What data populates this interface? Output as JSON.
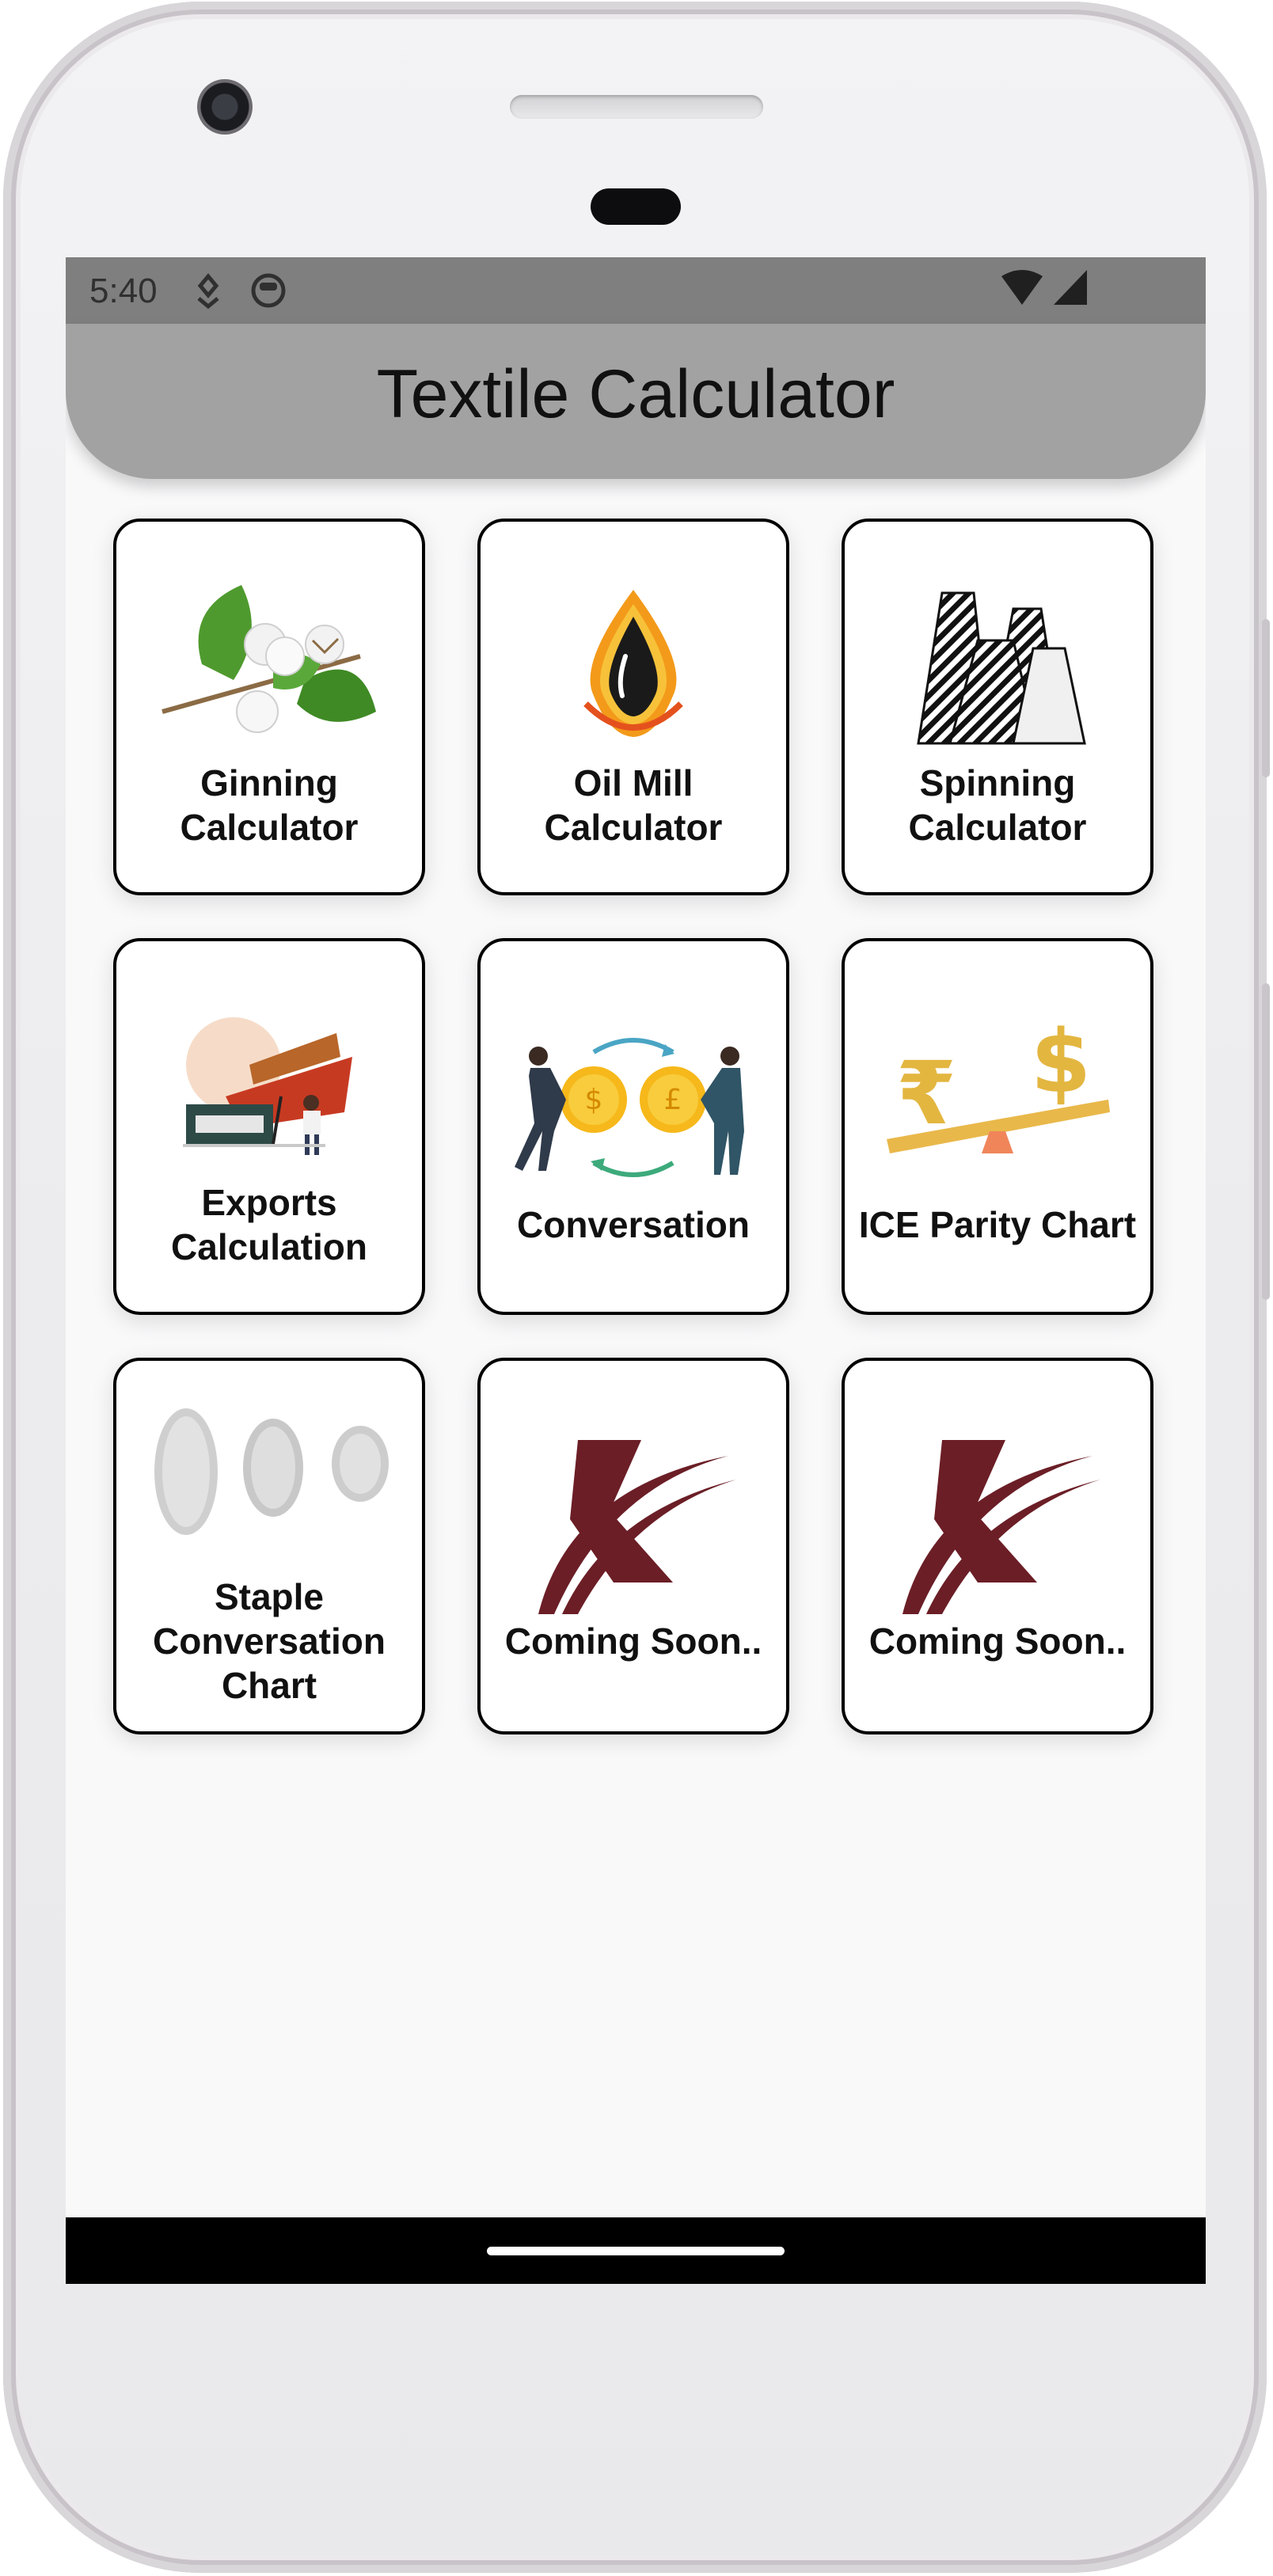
{
  "status_bar": {
    "time": "5:40",
    "icons": [
      "location-down-icon",
      "face-icon",
      "wifi-icon",
      "signal-icon"
    ]
  },
  "app_bar": {
    "title": "Textile Calculator"
  },
  "tiles": [
    {
      "label": "Ginning\nCalculator",
      "icon": "cotton-icon"
    },
    {
      "label": "Oil Mill\nCalculator",
      "icon": "oil-drop-icon"
    },
    {
      "label": "Spinning\nCalculator",
      "icon": "yarn-cones-icon"
    },
    {
      "label": "Exports\nCalculation",
      "icon": "export-ship-icon"
    },
    {
      "label": "Conversation",
      "icon": "currency-exchange-icon"
    },
    {
      "label": "ICE Parity Chart",
      "icon": "rupee-dollar-balance-icon"
    },
    {
      "label": "Staple\nConversation\nChart",
      "icon": "cotton-staple-icon"
    },
    {
      "label": "Coming Soon..",
      "icon": "k-logo-icon"
    },
    {
      "label": "Coming Soon..",
      "icon": "k-logo-icon"
    }
  ],
  "colors": {
    "app_bar": "#a2a2a2",
    "status_bar": "#7f7f7f",
    "logo": "#6b1e26"
  }
}
